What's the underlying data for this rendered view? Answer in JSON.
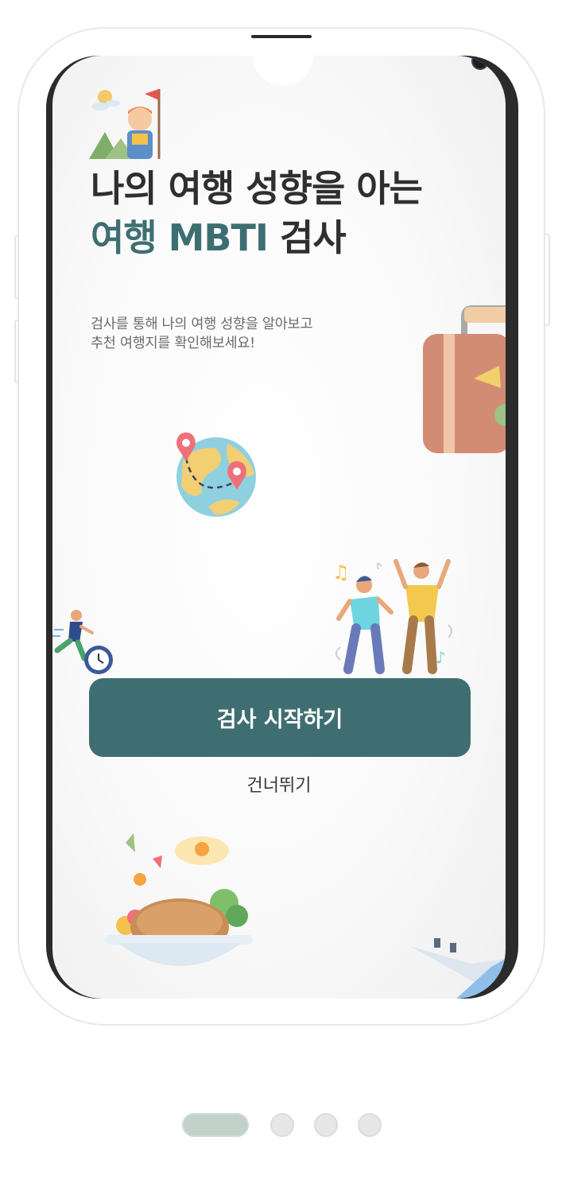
{
  "hero": {
    "title_line1": "나의 여행 성향을 아는",
    "title_accent": "여행 MBTI",
    "title_rest": " 검사",
    "subtitle_line1": "검사를 통해 나의 여행 성향을 알아보고",
    "subtitle_line2": "추천 여행지를 확인해보세요!"
  },
  "actions": {
    "start_label": "검사 시작하기",
    "skip_label": "건너뛰기"
  },
  "pager": {
    "total_pages": 4,
    "current_page": 1
  },
  "colors": {
    "accent": "#3f6e72",
    "title_text": "#2f2f2f",
    "pager_active": "#c2d1c9",
    "pager_inactive": "#e7e7e7"
  },
  "illustrations": [
    "hiker-icon",
    "suitcase-icon",
    "globe-icon",
    "dancers-icon",
    "runner-clock-icon",
    "food-bowl-icon",
    "airplane-icon"
  ]
}
